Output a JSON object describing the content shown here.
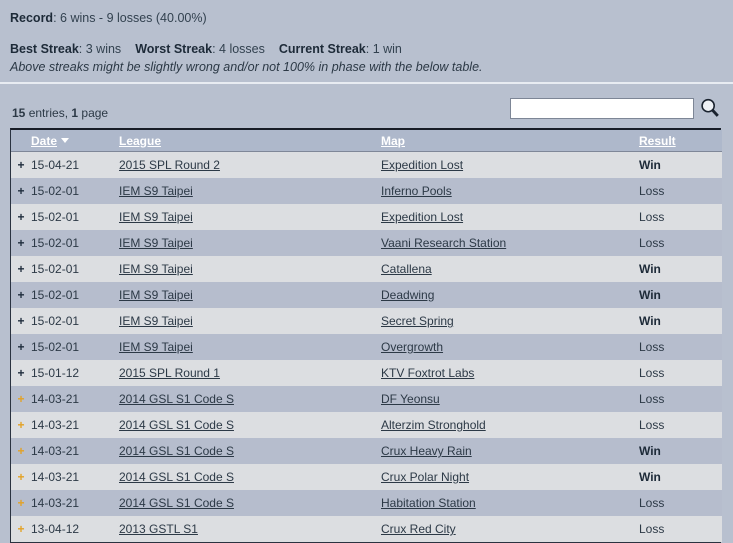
{
  "summary": {
    "record": {
      "label": "Record",
      "separator": ": ",
      "value": "6 wins - 9 losses (40.00%)"
    },
    "streaks": [
      {
        "label": "Best Streak",
        "separator": ": ",
        "value": "3 wins"
      },
      {
        "label": "Worst Streak",
        "separator": ": ",
        "value": "4 losses"
      },
      {
        "label": "Current Streak",
        "separator": ": ",
        "value": "1 win"
      }
    ],
    "note": "Above streaks might be slightly wrong and/or not 100% in phase with the below table."
  },
  "toolbar": {
    "entries_count": "15",
    "entries_word": " entries, ",
    "pages_count": "1",
    "pages_word": " page",
    "search": {
      "value": "",
      "placeholder": "",
      "icon": "search-icon"
    }
  },
  "table": {
    "columns": [
      {
        "key": "expand",
        "label": ""
      },
      {
        "key": "date",
        "label": "Date",
        "sorted": true,
        "sort_direction": "desc",
        "sort_icon": "chevron-down-icon"
      },
      {
        "key": "league",
        "label": "League"
      },
      {
        "key": "map",
        "label": "Map"
      },
      {
        "key": "result",
        "label": "Result"
      }
    ],
    "expand_icon": "plus-icon",
    "rows": [
      {
        "expand": "+",
        "expand_color": "dark",
        "date": "15-04-21",
        "league": "2015 SPL Round 2",
        "map": "Expedition Lost",
        "result": "Win"
      },
      {
        "expand": "+",
        "expand_color": "dark",
        "date": "15-02-01",
        "league": "IEM S9 Taipei",
        "map": "Inferno Pools",
        "result": "Loss"
      },
      {
        "expand": "+",
        "expand_color": "dark",
        "date": "15-02-01",
        "league": "IEM S9 Taipei",
        "map": "Expedition Lost",
        "result": "Loss"
      },
      {
        "expand": "+",
        "expand_color": "dark",
        "date": "15-02-01",
        "league": "IEM S9 Taipei",
        "map": "Vaani Research Station",
        "result": "Loss"
      },
      {
        "expand": "+",
        "expand_color": "dark",
        "date": "15-02-01",
        "league": "IEM S9 Taipei",
        "map": "Catallena",
        "result": "Win"
      },
      {
        "expand": "+",
        "expand_color": "dark",
        "date": "15-02-01",
        "league": "IEM S9 Taipei",
        "map": "Deadwing",
        "result": "Win"
      },
      {
        "expand": "+",
        "expand_color": "dark",
        "date": "15-02-01",
        "league": "IEM S9 Taipei",
        "map": "Secret Spring",
        "result": "Win"
      },
      {
        "expand": "+",
        "expand_color": "dark",
        "date": "15-02-01",
        "league": "IEM S9 Taipei",
        "map": "Overgrowth",
        "result": "Loss"
      },
      {
        "expand": "+",
        "expand_color": "dark",
        "date": "15-01-12",
        "league": "2015 SPL Round 1",
        "map": "KTV Foxtrot Labs",
        "result": "Loss"
      },
      {
        "expand": "+",
        "expand_color": "gold",
        "date": "14-03-21",
        "league": "2014 GSL S1 Code S",
        "map": "DF Yeonsu",
        "result": "Loss"
      },
      {
        "expand": "+",
        "expand_color": "gold",
        "date": "14-03-21",
        "league": "2014 GSL S1 Code S",
        "map": "Alterzim Stronghold",
        "result": "Loss"
      },
      {
        "expand": "+",
        "expand_color": "gold",
        "date": "14-03-21",
        "league": "2014 GSL S1 Code S",
        "map": "Crux Heavy Rain",
        "result": "Win"
      },
      {
        "expand": "+",
        "expand_color": "gold",
        "date": "14-03-21",
        "league": "2014 GSL S1 Code S",
        "map": "Crux Polar Night",
        "result": "Win"
      },
      {
        "expand": "+",
        "expand_color": "gold",
        "date": "14-03-21",
        "league": "2014 GSL S1 Code S",
        "map": "Habitation Station",
        "result": "Loss"
      },
      {
        "expand": "+",
        "expand_color": "gold",
        "date": "13-04-12",
        "league": "2013 GSTL S1",
        "map": "Crux Red City",
        "result": "Loss"
      }
    ]
  },
  "colors": {
    "page_background": "#b8c0cf",
    "header_row": "#aeb8cb",
    "row_odd": "#dcdee1",
    "row_even": "#b6bdcd",
    "text": "#2c3946",
    "gold_plus": "#e3a225"
  }
}
